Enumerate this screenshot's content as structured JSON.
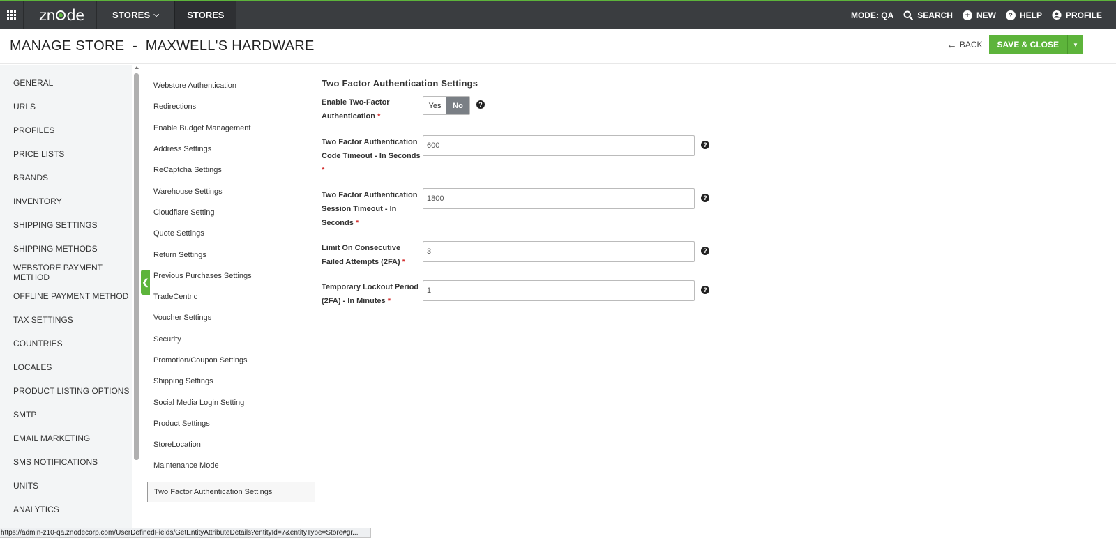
{
  "topbar": {
    "logo_text": "znode",
    "stores_menu_label": "STORES",
    "active_tab_label": "STORES",
    "mode_label": "MODE: QA",
    "search_label": "SEARCH",
    "new_label": "NEW",
    "help_label": "HELP",
    "profile_label": "PROFILE",
    "accent_color": "#5db43b",
    "bar_color": "#3a3d40"
  },
  "header": {
    "title": "MANAGE STORE  -  MAXWELL'S HARDWARE",
    "back_label": "BACK",
    "save_label": "SAVE & CLOSE"
  },
  "sidebar": {
    "items": [
      "GENERAL",
      "URLS",
      "PROFILES",
      "PRICE LISTS",
      "BRANDS",
      "INVENTORY",
      "SHIPPING SETTINGS",
      "SHIPPING METHODS",
      "WEBSTORE PAYMENT METHOD",
      "OFFLINE PAYMENT METHOD",
      "TAX SETTINGS",
      "COUNTRIES",
      "LOCALES",
      "PRODUCT LISTING OPTIONS",
      "SMTP",
      "EMAIL MARKETING",
      "SMS NOTIFICATIONS",
      "UNITS",
      "ANALYTICS"
    ]
  },
  "subnav": {
    "items": [
      "Webstore Authentication",
      "Redirections",
      "Enable Budget Management",
      "Address Settings",
      "ReCaptcha Settings",
      "Warehouse Settings",
      "Cloudflare Setting",
      "Quote Settings",
      "Return Settings",
      "Previous Purchases Settings",
      "TradeCentric",
      "Voucher Settings",
      "Security",
      "Promotion/Coupon Settings",
      "Shipping Settings",
      "Social Media Login Setting",
      "Product Settings",
      "StoreLocation",
      "Maintenance Mode"
    ],
    "active_item": "Two Factor Authentication Settings"
  },
  "form": {
    "title": "Two Factor Authentication Settings",
    "enable_label_1": "Enable Two-Factor",
    "enable_label_2": "Authentication",
    "toggle_yes": "Yes",
    "toggle_no": "No",
    "toggle_selected": "No",
    "code_timeout_label_1": "Two Factor Authentication",
    "code_timeout_label_2": "Code Timeout - In Seconds",
    "code_timeout_value": "600",
    "session_timeout_label_1": "Two Factor Authentication",
    "session_timeout_label_2": "Session Timeout - In",
    "session_timeout_label_3": "Seconds",
    "session_timeout_value": "1800",
    "failed_attempts_label_1": "Limit On Consecutive",
    "failed_attempts_label_2": "Failed Attempts (2FA)",
    "failed_attempts_value": "3",
    "lockout_label_1": "Temporary Lockout Period",
    "lockout_label_2": "(2FA) - In Minutes",
    "lockout_value": "1",
    "required_mark": "*"
  },
  "statusbar": {
    "url": "https://admin-z10-qa.znodecorp.com/UserDefinedFields/GetEntityAttributeDetails?entityId=7&entityType=Store#gr..."
  }
}
